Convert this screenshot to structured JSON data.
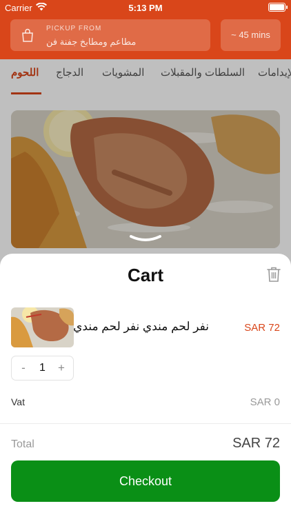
{
  "status_bar": {
    "carrier": "Carrier",
    "time": "5:13 PM"
  },
  "header": {
    "pickup_label": "PICKUP FROM",
    "pickup_value": "مطاعم ومطابخ جفنة فن",
    "eta": "~ 45 mins",
    "accent_color": "#d9461a"
  },
  "tabs": [
    {
      "label": "اللحوم",
      "active": true
    },
    {
      "label": "الدجاج",
      "active": false
    },
    {
      "label": "المشويات",
      "active": false
    },
    {
      "label": "السلطات والمقبلات",
      "active": false
    },
    {
      "label": "الإيدامات",
      "active": false
    }
  ],
  "cart": {
    "title": "Cart",
    "item": {
      "name": "نفر لحم مندي نفر لحم مندي",
      "price": "SAR 72",
      "quantity": "1",
      "minus": "-",
      "plus": "+"
    },
    "vat_label": "Vat",
    "vat_value": "SAR 0",
    "total_label": "Total",
    "total_value": "SAR 72",
    "checkout_label": "Checkout",
    "checkout_color": "#0a8f16"
  }
}
